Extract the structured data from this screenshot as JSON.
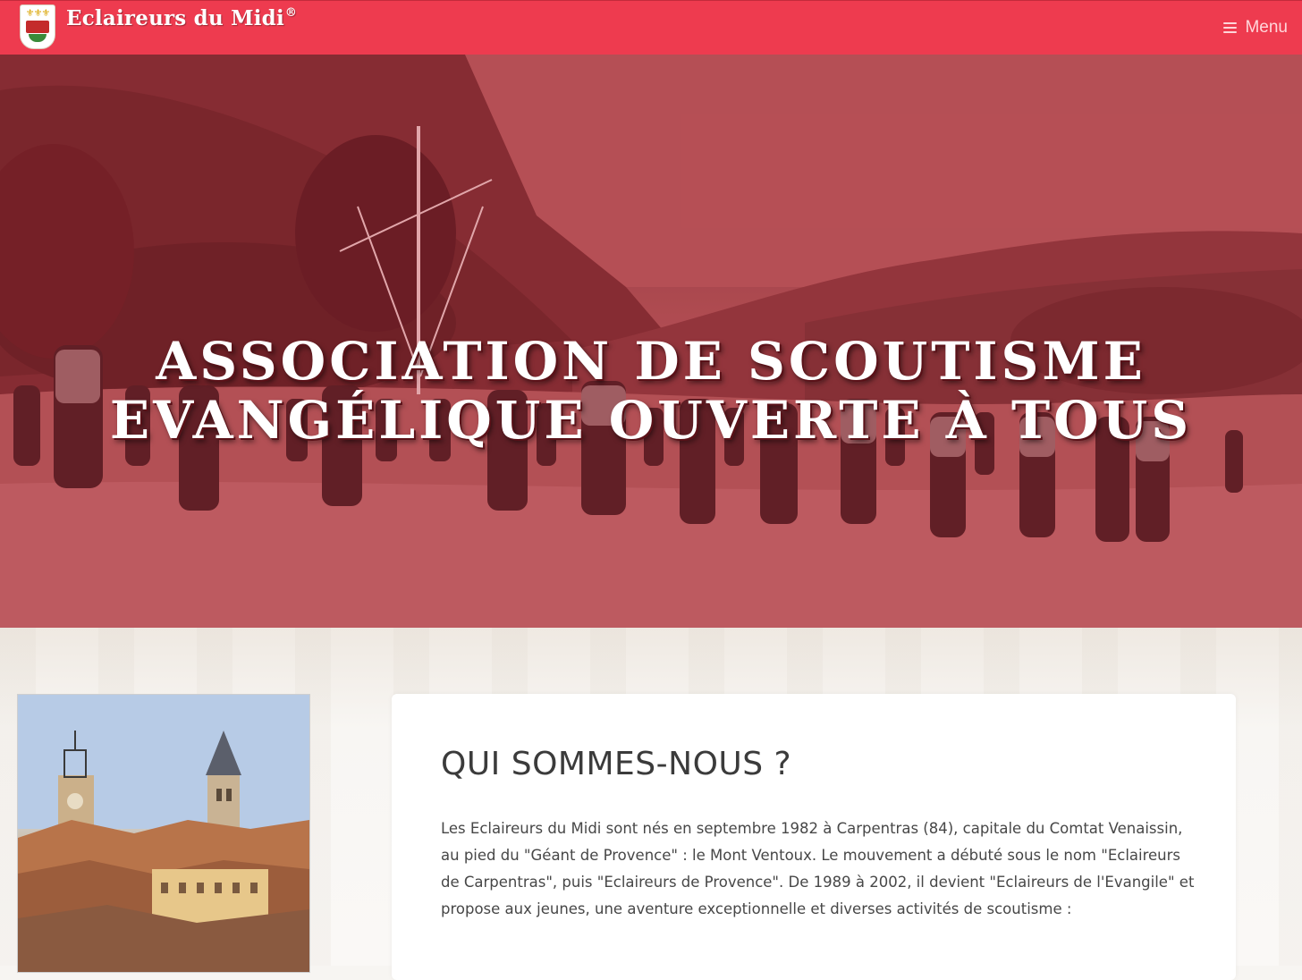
{
  "navbar": {
    "brand_name": "Eclaireurs du Midi",
    "brand_mark": "®",
    "menu_label": "Menu",
    "menu_icon": "bars-icon",
    "bg_color": "#ee3b4f"
  },
  "hero": {
    "title_line1": "ASSOCIATION DE SCOUTISME",
    "title_line2": "EVANGÉLIQUE OUVERTE À TOUS",
    "overlay_color": "#b03a45"
  },
  "about": {
    "heading": "QUI SOMMES-NOUS ?",
    "paragraph": "Les Eclaireurs du Midi sont nés en septembre 1982 à Carpentras (84), capitale du Comtat Venaissin, au pied du \"Géant de Provence\" : le Mont Ventoux. Le mouvement a débuté sous le nom \"Eclaireurs de Carpentras\", puis \"Eclaireurs de Provence\". De 1989 à 2002, il devient \"Eclaireurs de l'Evangile\" et propose aux jeunes, une aventure exceptionnelle et diverses activités de scoutisme :"
  }
}
